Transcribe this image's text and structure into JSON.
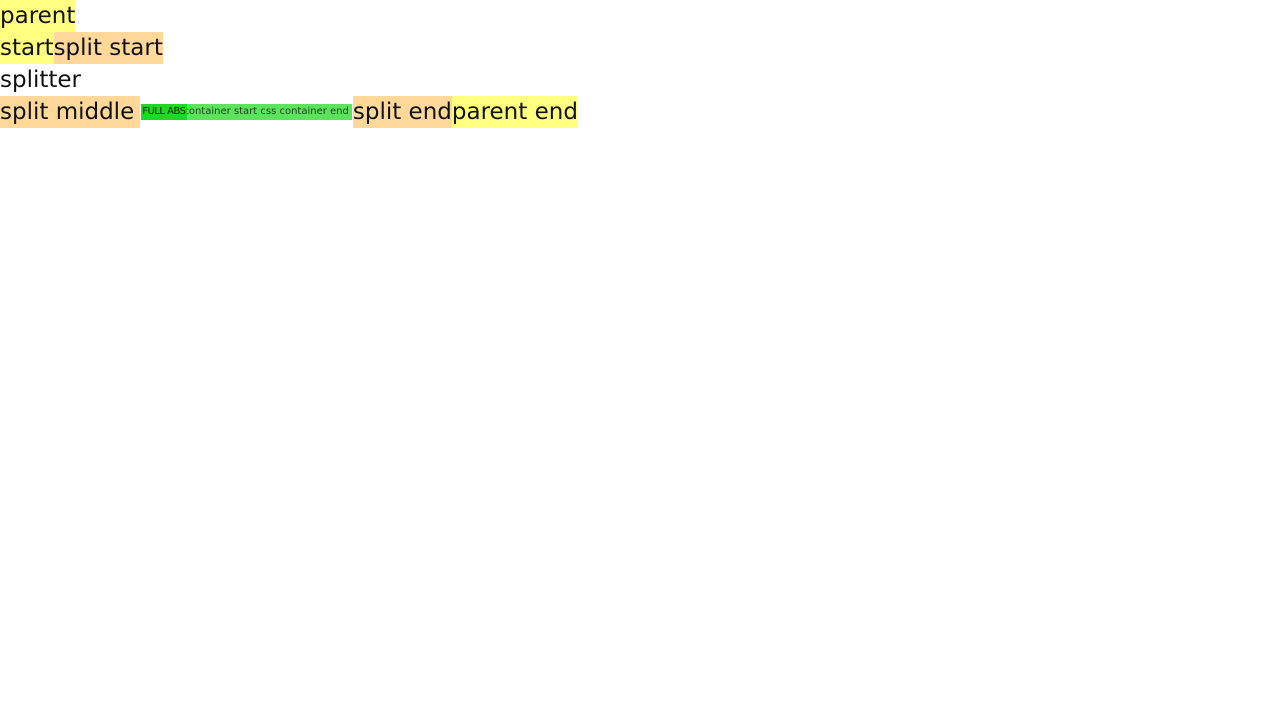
{
  "line1": {
    "parent": "parent"
  },
  "line2": {
    "start": "start",
    "split_start": "split start"
  },
  "line3": {
    "splitter": "splitter"
  },
  "line4": {
    "split_middle": "split middle",
    "abs_label": "FULL ABS",
    "container_text": "css container start css container end",
    "split_end": "split end",
    "parent_end": "parent end"
  },
  "colors": {
    "parent_bg": "#ffff80",
    "split_bg": "#ffd89a",
    "container_bg": "#5be35b",
    "abs_bg": "#22d622"
  }
}
